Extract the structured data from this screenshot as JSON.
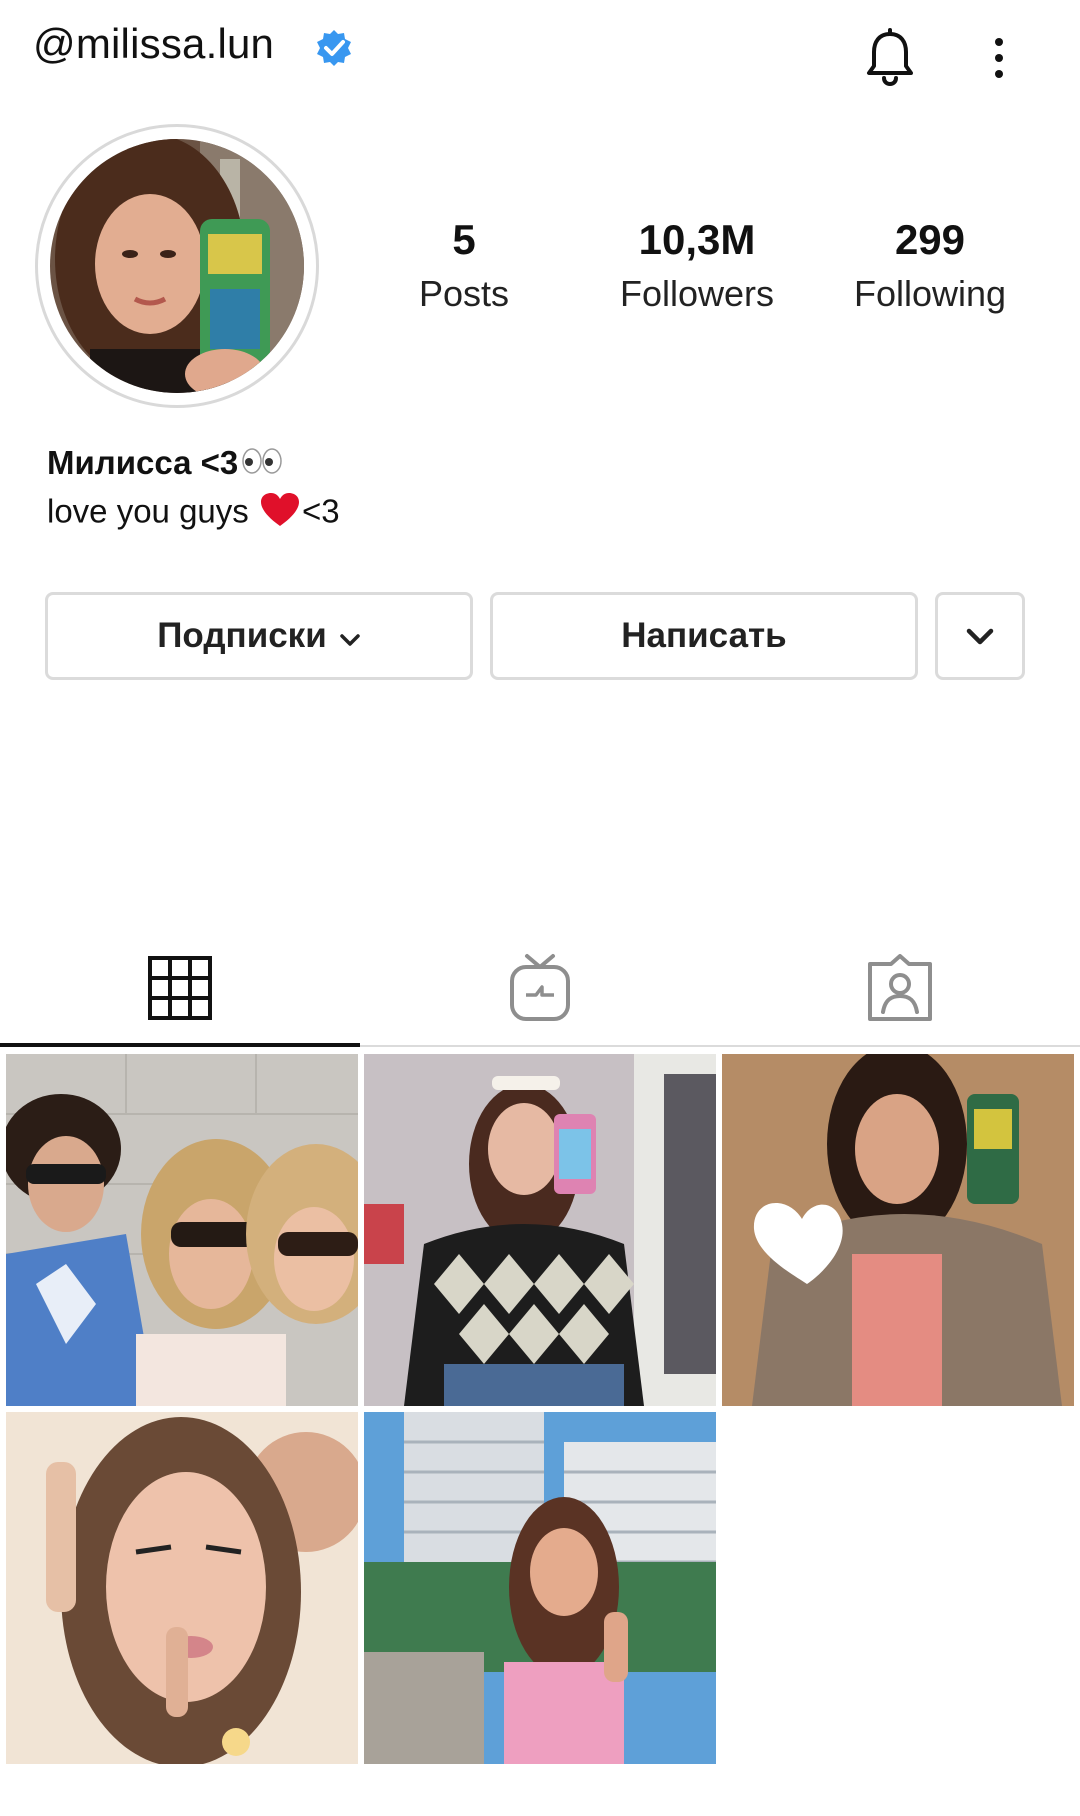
{
  "header": {
    "username": "@milissa.lun",
    "verified_icon": "verified-badge-icon",
    "bell_icon": "bell-icon",
    "more_icon": "more-vertical-icon"
  },
  "profile": {
    "avatar_icon": "profile-photo",
    "stats": {
      "posts": {
        "value": "5",
        "label": "Posts"
      },
      "followers": {
        "value": "10,3M",
        "label": "Followers"
      },
      "following": {
        "value": "299",
        "label": "Following"
      }
    },
    "bio": {
      "name": "Милисса <3",
      "name_emoji": "eyes-emoji",
      "line_before_heart": "love you guys ",
      "line_after_heart": "<3"
    }
  },
  "actions": {
    "subscriptions_label": "Подписки",
    "message_label": "Написать"
  },
  "tabs": [
    {
      "icon": "grid-icon",
      "active": true
    },
    {
      "icon": "igtv-icon",
      "active": false
    },
    {
      "icon": "tagged-icon",
      "active": false
    }
  ],
  "posts_count_shown": 5,
  "colors": {
    "verified": "#3897f0",
    "border": "#dbdbdb",
    "heart": "#e0102a"
  }
}
